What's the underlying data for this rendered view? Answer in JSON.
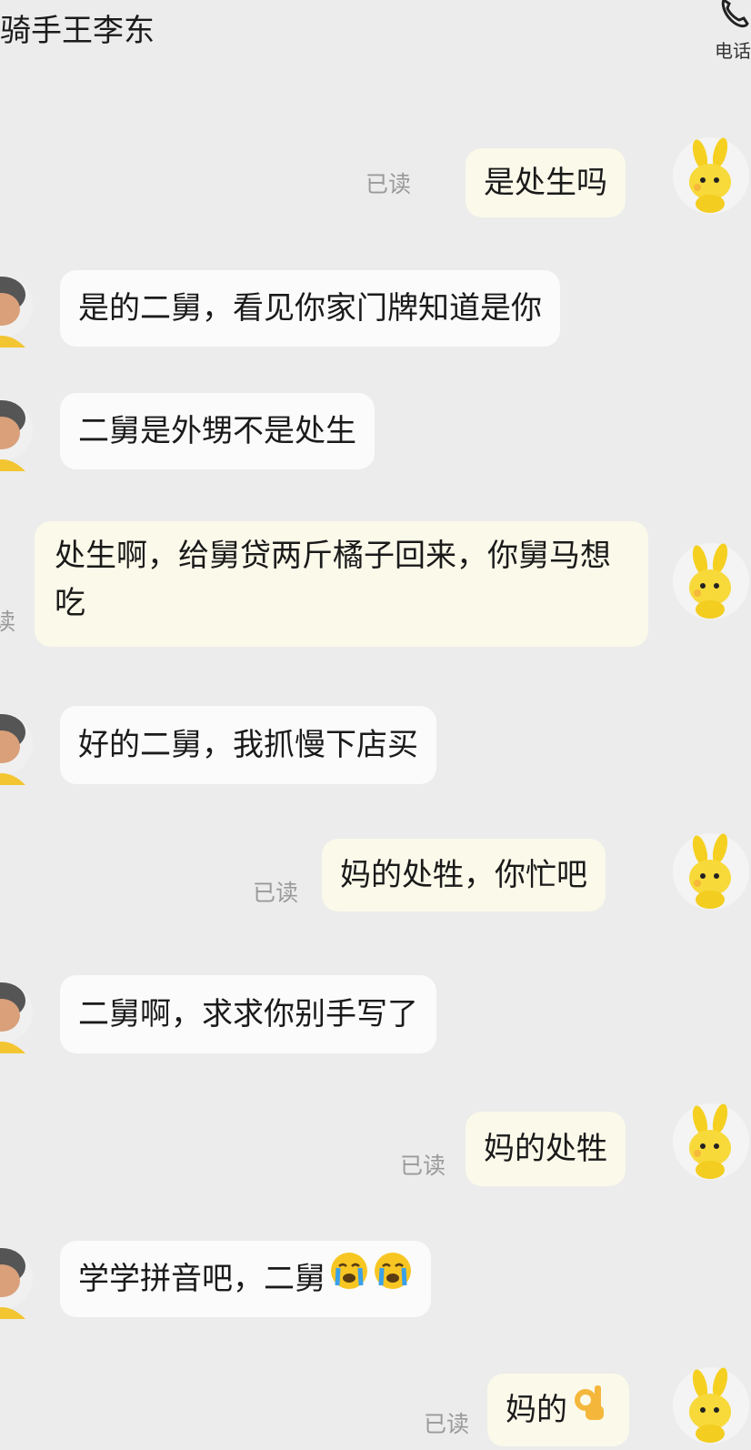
{
  "header": {
    "title": "骑手王李东",
    "call_label": "电话"
  },
  "messages": [
    {
      "side": "right",
      "text": "是处生吗",
      "status": "已读"
    },
    {
      "side": "left",
      "text": "是的二舅，看见你家门牌知道是你"
    },
    {
      "side": "left",
      "text": "二舅是外甥不是处生"
    },
    {
      "side": "right",
      "text": "处生啊，给舅贷两斤橘子回来，你舅马想吃",
      "status": "读"
    },
    {
      "side": "left",
      "text": "好的二舅，我抓慢下店买"
    },
    {
      "side": "right",
      "text": "妈的处牲，你忙吧",
      "status": "已读"
    },
    {
      "side": "left",
      "text": "二舅啊，求求你别手写了"
    },
    {
      "side": "right",
      "text": "妈的处牲",
      "status": "已读"
    },
    {
      "side": "left",
      "text": "学学拼音吧，二舅",
      "emoji": [
        "crying-face",
        "crying-face"
      ]
    },
    {
      "side": "right",
      "text": "妈的",
      "status": "已读",
      "emoji": [
        "ok-hand"
      ]
    }
  ],
  "colors": {
    "background": "#ececec",
    "incoming_bubble": "#fbfbfb",
    "outgoing_bubble": "#fbf9ea",
    "read_status": "#9a9a9a"
  }
}
